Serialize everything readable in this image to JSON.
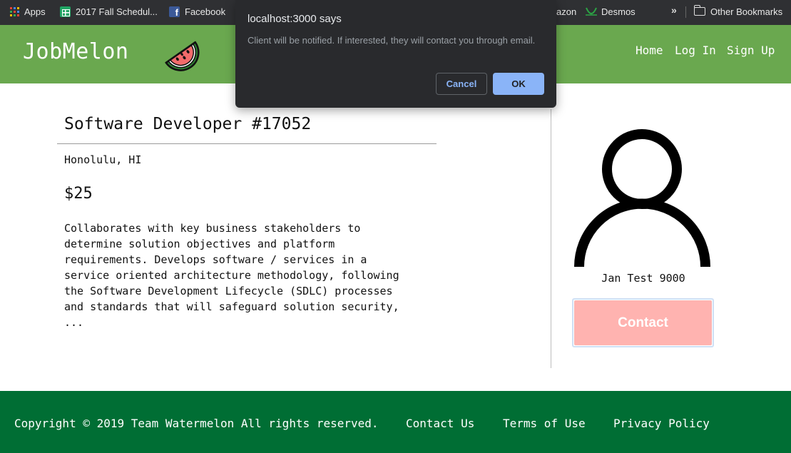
{
  "bookmarks_bar": {
    "apps": "Apps",
    "sheet": "2017 Fall Schedul...",
    "facebook": "Facebook",
    "amazon_partial": "azon",
    "desmos": "Desmos",
    "more": "»",
    "other": "Other Bookmarks",
    "apps_colors": [
      "#ea4335",
      "#4285f4",
      "#fbbc05",
      "#34a853",
      "#ea4335",
      "#4285f4",
      "#fbbc05",
      "#34a853",
      "#ea4335"
    ]
  },
  "header": {
    "brand": "JobMelon",
    "nav": [
      "Home",
      "Log In",
      "Sign Up"
    ],
    "color": "#6aa84f"
  },
  "job": {
    "title": "Software Developer #17052",
    "location": "Honolulu, HI",
    "price": "$25",
    "description": "Collaborates with key business stakeholders to\ndetermine solution objectives and platform\nrequirements. Develops software / services in a\nservice oriented architecture methodology, following\nthe Software Development Lifecycle (SDLC) processes\nand standards that will safeguard solution security,\n..."
  },
  "profile": {
    "name": "Jan Test 9000",
    "contact_label": "Contact",
    "contact_color": "#ffb3b0"
  },
  "footer": {
    "copyright": "Copyright © 2019 Team Watermelon All rights reserved.",
    "links": [
      "Contact Us",
      "Terms of Use",
      "Privacy Policy"
    ],
    "color": "#006e34"
  },
  "dialog": {
    "title": "localhost:3000 says",
    "message": "Client will be notified. If interested, they will contact you through email.",
    "cancel_label": "Cancel",
    "ok_label": "OK"
  }
}
